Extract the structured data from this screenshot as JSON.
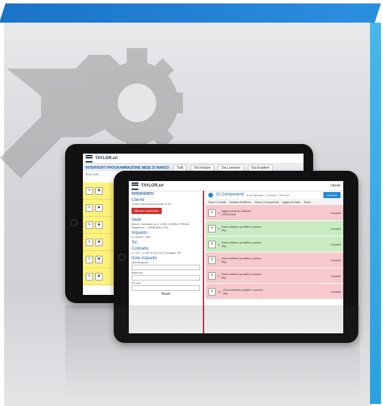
{
  "tablet_back": {
    "brand": "TAYLOR.srl",
    "title": "INTERVENTI PROGRAMMAZIONE MESE DI MARZO",
    "tabs": [
      "Tutti",
      "Da Iniziare",
      "Da Lavorare",
      "Da Evadere"
    ],
    "search_placeholder": "Barcode..."
  },
  "tablet_front": {
    "brand": "TAYLOR.srl",
    "user": "Utente",
    "section_title": "INTERVENTO",
    "cliente_label": "Cliente",
    "cliente_text": "17393 ORGANIZZAZIONE S.R.L.",
    "modifica": "Modifica",
    "elimina_btn": "Elimina Intervento",
    "sede_label": "Sede",
    "sede_text": "Mezzo Cambiano (p.e. 1049) CONSULTORIA A Magazzino - CAMBIANO (TO)",
    "impianto_label": "Impianto",
    "impianto_text": "N. MONO / IMP",
    "tel_label": "Tel.",
    "contratto_label": "Contratto",
    "contratto_text": "N. 102 / 12 del 30.03.2013 Tipologia: MP",
    "note_label": "Note impianto",
    "form_labels": [
      "Aliemergenze",
      "Posizione",
      "Matricola",
      "Ubicazione",
      "Rif. ant",
      "Tipo intervento"
    ],
    "reset": "Reset",
    "components_title": "10 Componenti",
    "components_sub": "5 da Fatturare, 3 parziali, 0 Rinviati",
    "components_btn": "Inserisci",
    "toolbar_items": [
      "Nuovi Controlli",
      "Annulla Modifiche",
      "Nuovo Componente",
      "Aggiorna Stato",
      "Salva"
    ],
    "col_headers": [
      "Pos.",
      "Componente",
      "Rif.ant / Classe",
      "Stato",
      "T.Int"
    ],
    "rows": [
      {
        "pos": "1",
        "name": "Aggiornamento sollecito / ISPEZIONE",
        "status": "Controlli"
      },
      {
        "pos": "3",
        "name": "Zona estintore portatile a polvere 6kg",
        "status": "Controlli"
      },
      {
        "pos": "5",
        "name": "Zona estintore portatile a polvere 6kg",
        "status": "Controlli"
      },
      {
        "pos": "7",
        "name": "Zona estintore portatile a polvere 6kg",
        "status": "Controlli"
      },
      {
        "pos": "9",
        "name": "Zona estintore portatile a polvere 6kg",
        "status": "Controlli"
      },
      {
        "pos": "10",
        "name": "Zona estintore portatile a polvere 6kg",
        "status": "Controlli"
      }
    ]
  },
  "colors": {
    "brand_blue": "#1a73c7",
    "side_blue": "#2aa0de",
    "row_red": "#f5c9cd",
    "row_green": "#c9ebc3",
    "row_yellow": "#fff27a"
  }
}
